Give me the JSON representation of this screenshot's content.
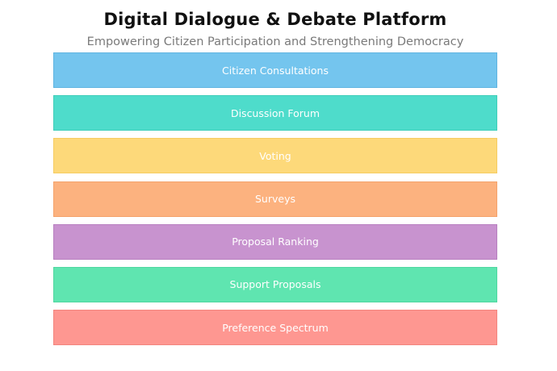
{
  "header": {
    "title": "Digital Dialogue & Debate Platform",
    "subtitle": "Empowering Citizen Participation and Strengthening Democracy"
  },
  "blocks": [
    {
      "label": "Citizen Consultations",
      "fill": "#74c5ee",
      "border": "#5fb4e1"
    },
    {
      "label": "Discussion Forum",
      "fill": "#4edccb",
      "border": "#3fcdb9"
    },
    {
      "label": "Voting",
      "fill": "#fdd97a",
      "border": "#f6cc62"
    },
    {
      "label": "Surveys",
      "fill": "#fcb27f",
      "border": "#f4a36c"
    },
    {
      "label": "Proposal Ranking",
      "fill": "#c893cf",
      "border": "#b880c0"
    },
    {
      "label": "Support Proposals",
      "fill": "#5fe5b0",
      "border": "#4fd7a0"
    },
    {
      "label": "Preference Spectrum",
      "fill": "#fe9791",
      "border": "#f3857e"
    }
  ]
}
